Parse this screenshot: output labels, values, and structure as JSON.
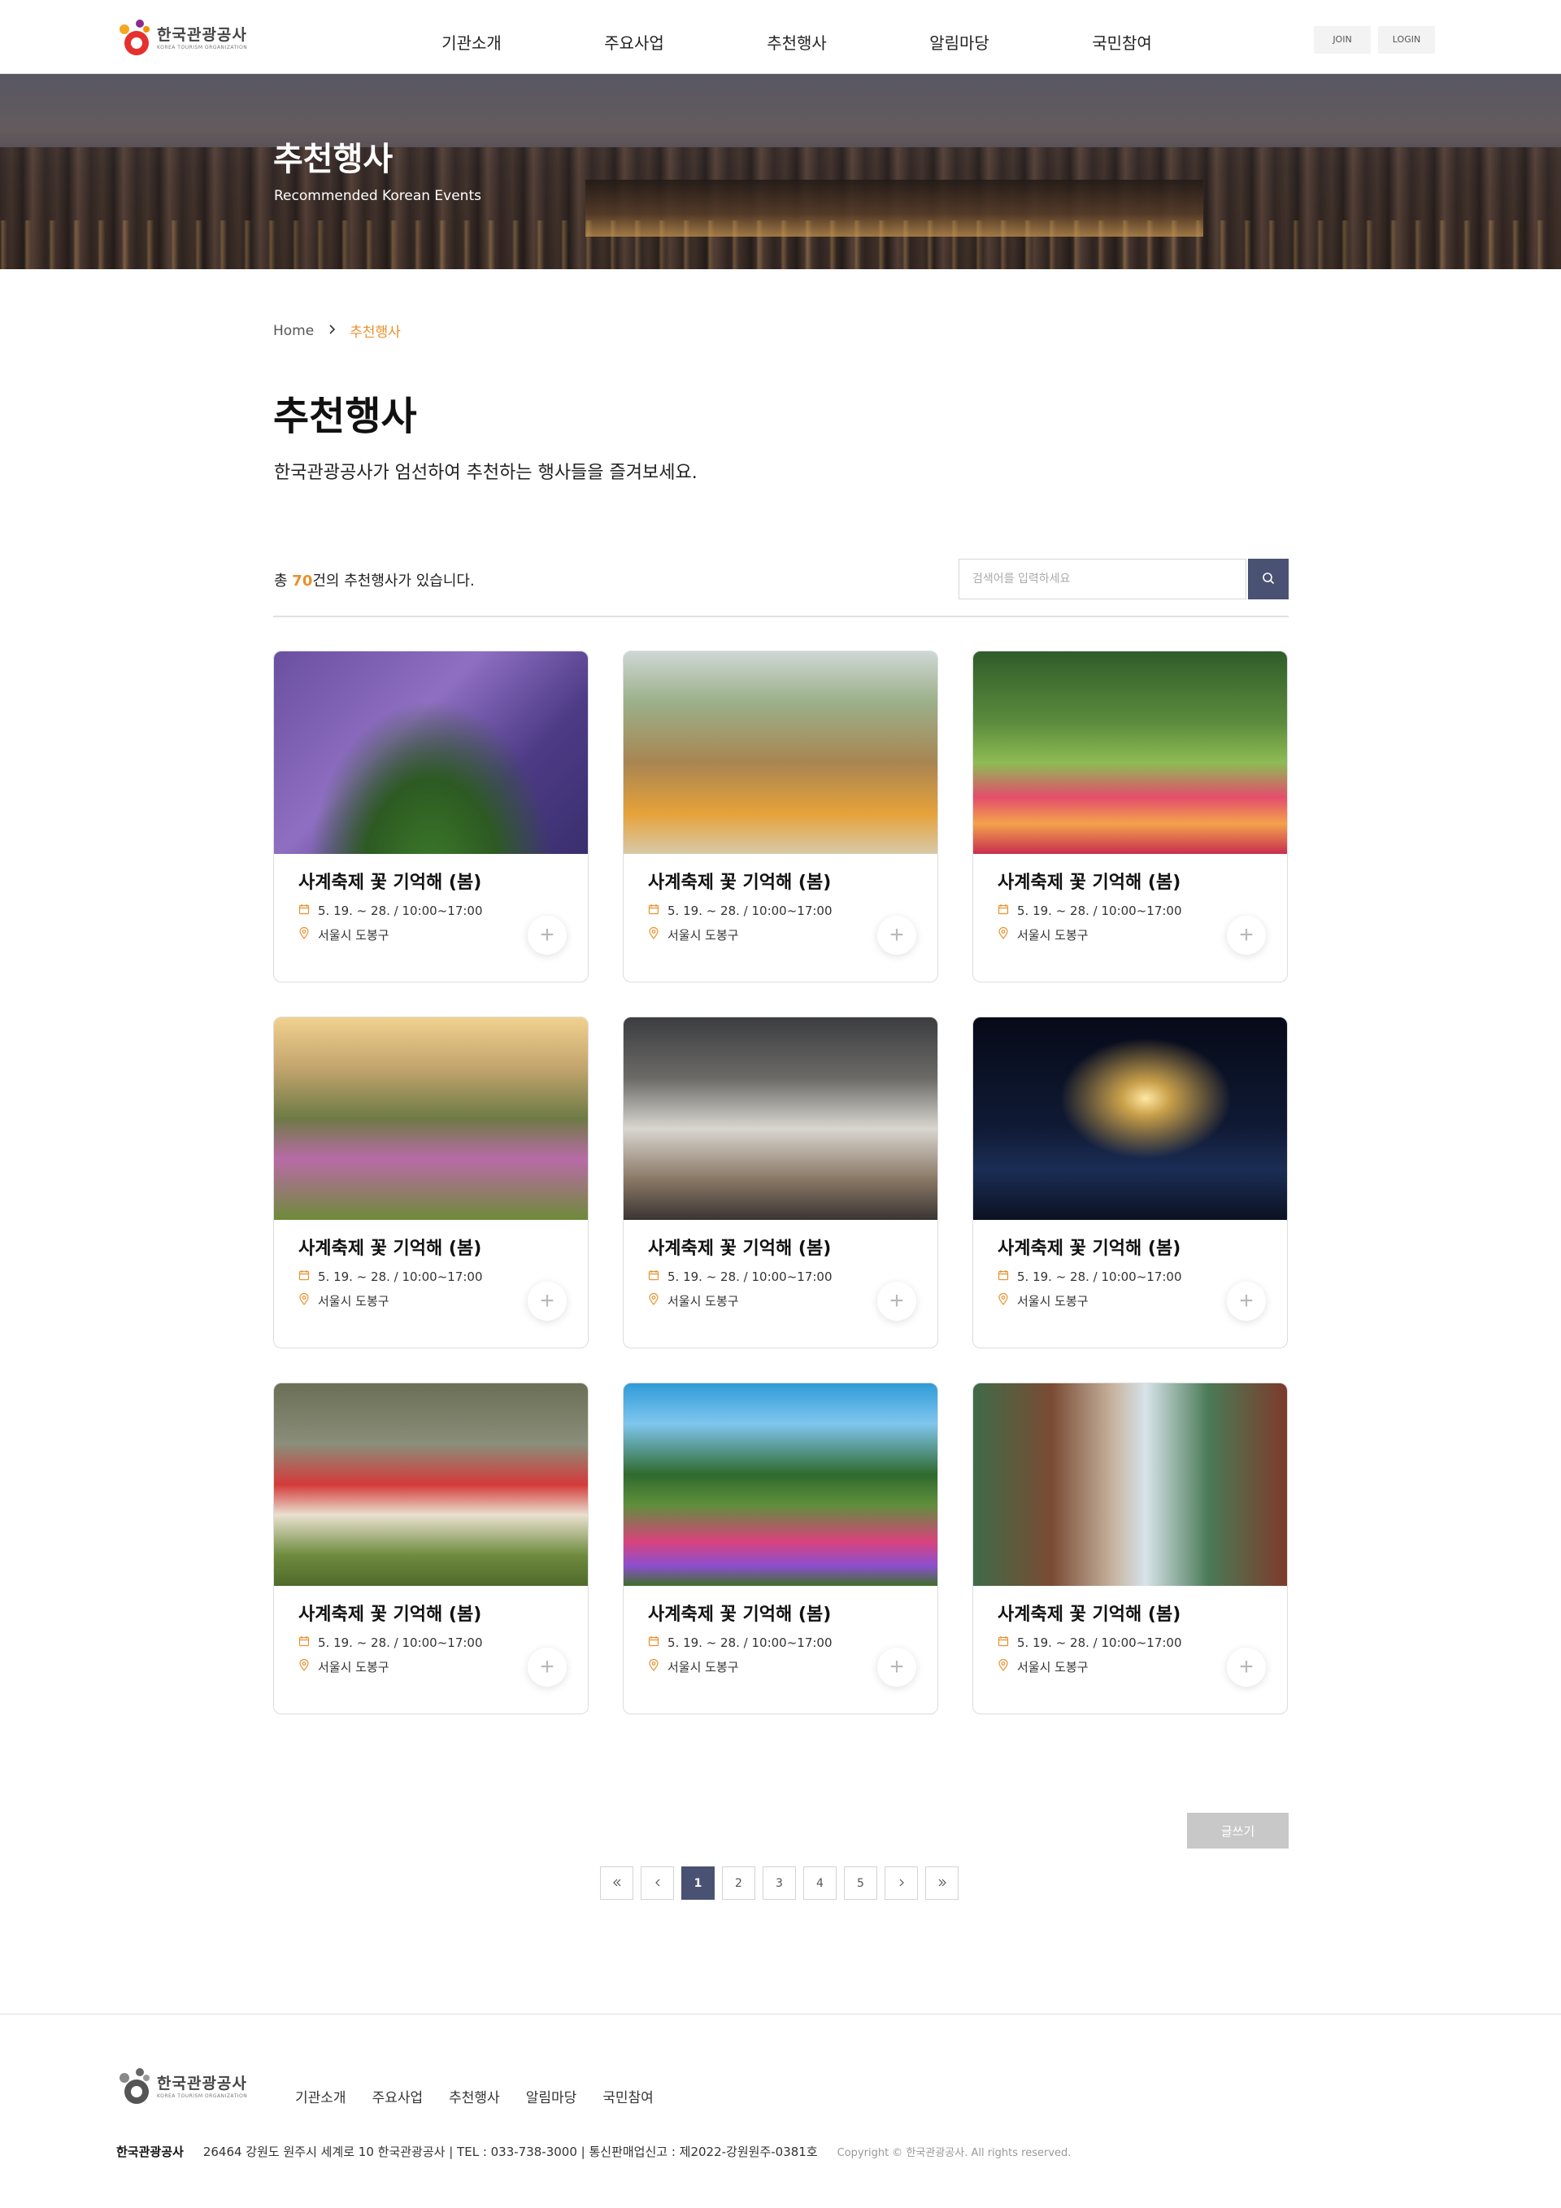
{
  "header": {
    "logo_ko": "한국관광공사",
    "logo_en": "KOREA TOURISM ORGANIZATION",
    "nav": [
      "기관소개",
      "주요사업",
      "추천행사",
      "알림마당",
      "국민참여"
    ],
    "join": "JOIN",
    "login": "LOGIN"
  },
  "banner": {
    "title": "추천행사",
    "subtitle": "Recommended Korean Events"
  },
  "breadcrumb": {
    "home": "Home",
    "current": "추천행사"
  },
  "page": {
    "title": "추천행사",
    "description": "한국관광공사가 엄선하여 추천하는 행사들을 즐겨보세요."
  },
  "count": {
    "prefix": "총 ",
    "number": "70",
    "suffix": "건의 추천행사가 있습니다."
  },
  "search": {
    "placeholder": "검색어를 입력하세요"
  },
  "events": [
    {
      "title": "사계축제 꽃 기억해 (봄)",
      "date": "5. 19. ~ 28. / 10:00~17:00",
      "location": "서울시 도봉구",
      "thumb": "t0"
    },
    {
      "title": "사계축제 꽃 기억해 (봄)",
      "date": "5. 19. ~ 28. / 10:00~17:00",
      "location": "서울시 도봉구",
      "thumb": "t1"
    },
    {
      "title": "사계축제 꽃 기억해 (봄)",
      "date": "5. 19. ~ 28. / 10:00~17:00",
      "location": "서울시 도봉구",
      "thumb": "t2"
    },
    {
      "title": "사계축제 꽃 기억해 (봄)",
      "date": "5. 19. ~ 28. / 10:00~17:00",
      "location": "서울시 도봉구",
      "thumb": "t3"
    },
    {
      "title": "사계축제 꽃 기억해 (봄)",
      "date": "5. 19. ~ 28. / 10:00~17:00",
      "location": "서울시 도봉구",
      "thumb": "t4"
    },
    {
      "title": "사계축제 꽃 기억해 (봄)",
      "date": "5. 19. ~ 28. / 10:00~17:00",
      "location": "서울시 도봉구",
      "thumb": "t5"
    },
    {
      "title": "사계축제 꽃 기억해 (봄)",
      "date": "5. 19. ~ 28. / 10:00~17:00",
      "location": "서울시 도봉구",
      "thumb": "t6"
    },
    {
      "title": "사계축제 꽃 기억해 (봄)",
      "date": "5. 19. ~ 28. / 10:00~17:00",
      "location": "서울시 도봉구",
      "thumb": "t7"
    },
    {
      "title": "사계축제 꽃 기억해 (봄)",
      "date": "5. 19. ~ 28. / 10:00~17:00",
      "location": "서울시 도봉구",
      "thumb": "t8"
    }
  ],
  "write_button": "글쓰기",
  "pagination": {
    "first": "«",
    "prev": "‹",
    "pages": [
      "1",
      "2",
      "3",
      "4",
      "5"
    ],
    "current": "1",
    "next": "›",
    "last": "»"
  },
  "footer": {
    "logo_ko": "한국관광공사",
    "logo_en": "KOREA TOURISM ORGANIZATION",
    "nav": [
      "기관소개",
      "주요사업",
      "추천행사",
      "알림마당",
      "국민참여"
    ],
    "org": "한국관광공사",
    "address": "26464 강원도 원주시 세계로 10 한국관광공사 | TEL : 033-738-3000 | 통신판매업신고 : 제2022-강원원주-0381호",
    "copyright": "Copyright © 한국관광공사. All rights reserved."
  },
  "colors": {
    "accent": "#e8912d",
    "primary": "#4a5273"
  }
}
